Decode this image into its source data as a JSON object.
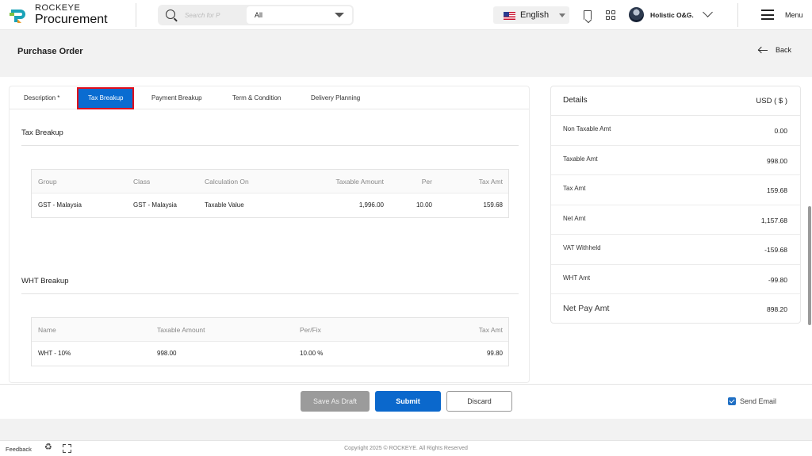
{
  "app": {
    "brand_top": "ROCKEYE",
    "brand_bottom": "Procurement"
  },
  "header": {
    "search_placeholder": "Search for P",
    "search_scope": "All",
    "language": "English",
    "user_name": "Holistic O&G.",
    "menu_label": "Menu"
  },
  "page": {
    "title": "Purchase Order",
    "back_label": "Back"
  },
  "tabs": [
    {
      "label": "Description *"
    },
    {
      "label": "Tax Breakup"
    },
    {
      "label": "Payment Breakup"
    },
    {
      "label": "Term & Condition"
    },
    {
      "label": "Delivery Planning"
    }
  ],
  "tax_breakup": {
    "title": "Tax Breakup",
    "headers": [
      "Group",
      "Class",
      "Calculation On",
      "Taxable Amount",
      "Per",
      "Tax Amt"
    ],
    "rows": [
      [
        "GST - Malaysia",
        "GST - Malaysia",
        "Taxable Value",
        "1,996.00",
        "10.00",
        "159.68"
      ]
    ]
  },
  "wht_breakup": {
    "title": "WHT Breakup",
    "headers": [
      "Name",
      "Taxable Amount",
      "Per/Fix",
      "Tax Amt"
    ],
    "rows": [
      [
        "WHT - 10%",
        "998.00",
        "10.00 %",
        "99.80"
      ]
    ]
  },
  "details": {
    "title": "Details",
    "currency": "USD ( $ )",
    "rows": [
      {
        "label": "Non Taxable Amt",
        "value": "0.00"
      },
      {
        "label": "Taxable Amt",
        "value": "998.00"
      },
      {
        "label": "Tax Amt",
        "value": "159.68"
      },
      {
        "label": "Net Amt",
        "value": "1,157.68"
      },
      {
        "label": "VAT Withheld",
        "value": "-159.68"
      },
      {
        "label": "WHT Amt",
        "value": "-99.80"
      },
      {
        "label": "Net Pay Amt",
        "value": "898.20"
      }
    ]
  },
  "actions": {
    "save_draft": "Save As Draft",
    "submit": "Submit",
    "discard": "Discard",
    "send_email": "Send Email"
  },
  "footer": {
    "feedback": "Feedback",
    "copyright": "Copyright 2025 © ROCKEYE. All Rights Reserved"
  },
  "colors": {
    "primary": "#0b68cc",
    "active_tab_outline": "#e00d1c",
    "draft_button": "#9b9b9b"
  },
  "icons": [
    "logo-icon",
    "search-icon",
    "us-flag-icon",
    "bookmark-icon",
    "apps-grid-icon",
    "avatar",
    "chevron-down-icon",
    "hamburger-menu-icon",
    "back-arrow-icon",
    "checkbox-checked-icon",
    "recycle-icon",
    "expand-icon"
  ]
}
